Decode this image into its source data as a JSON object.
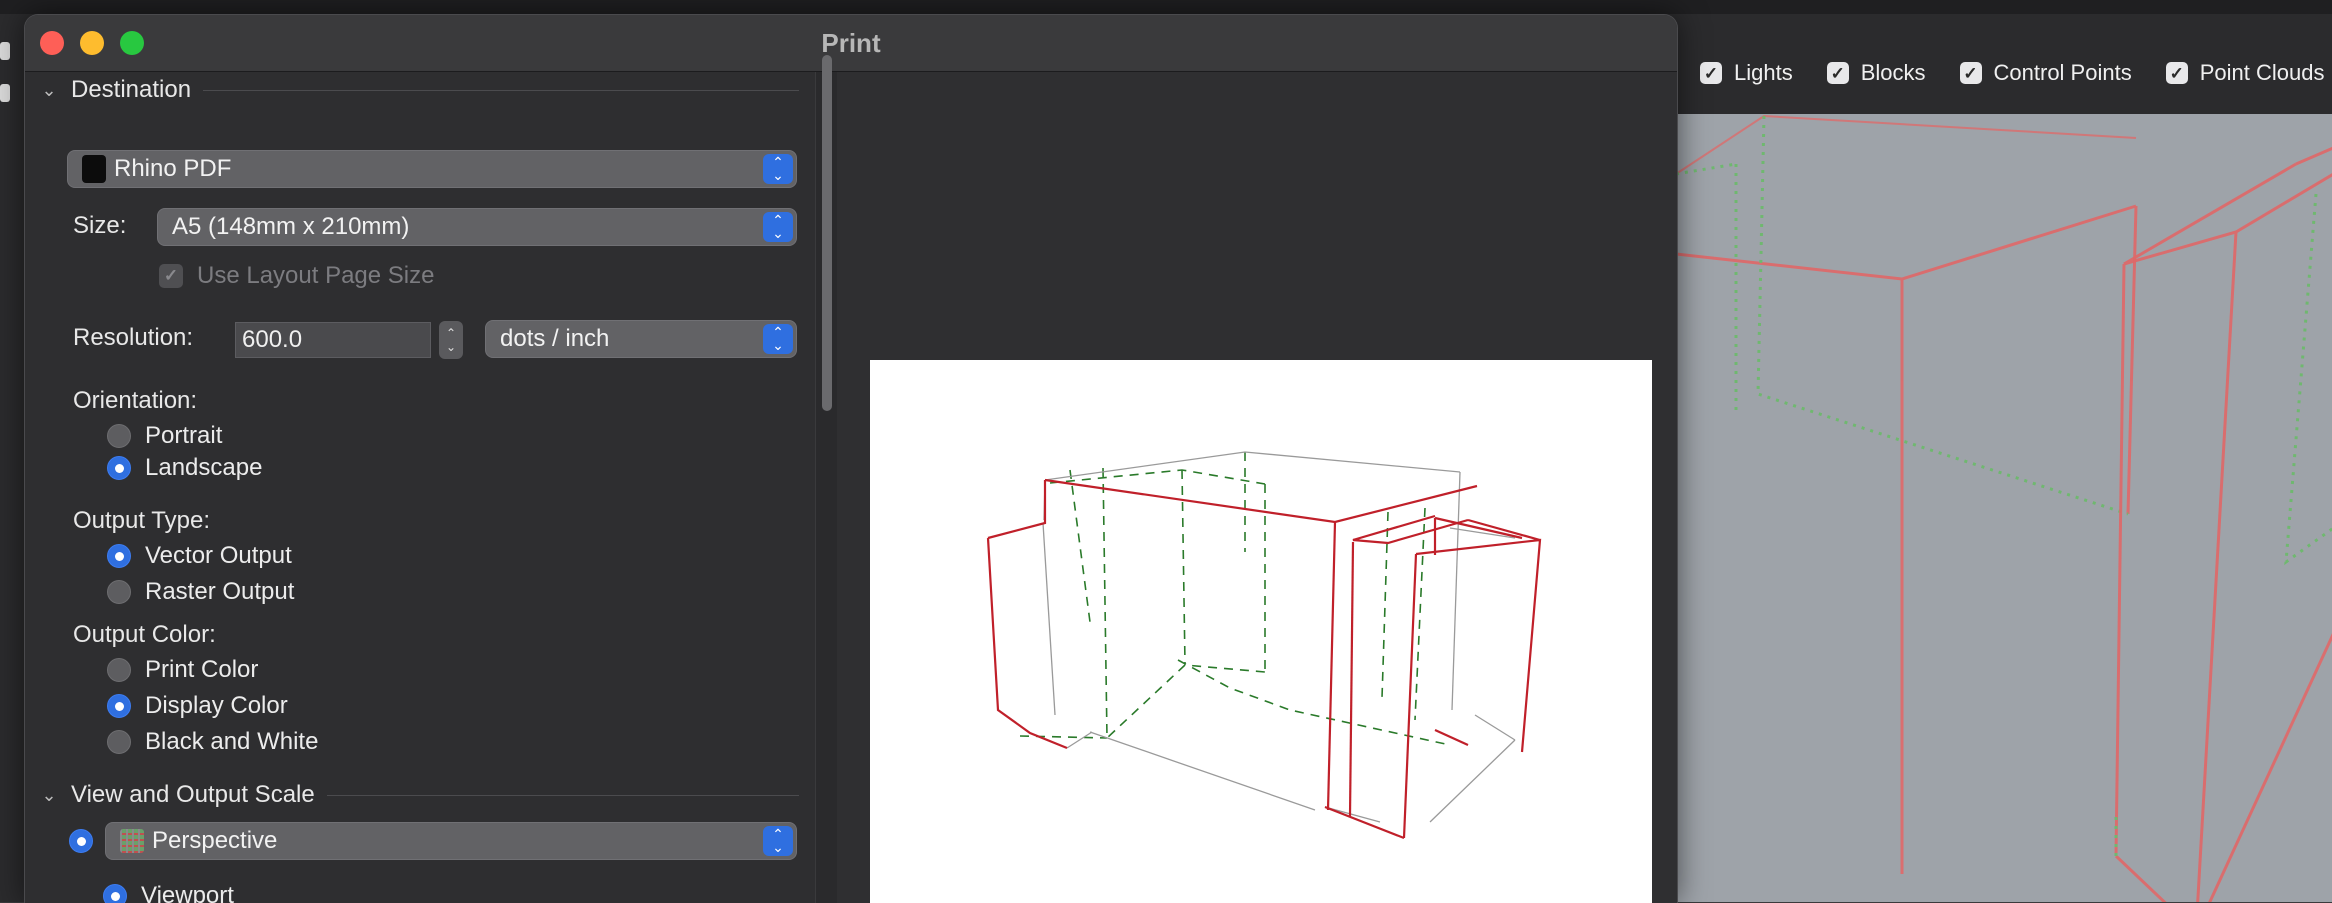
{
  "dialog": {
    "title": "Print",
    "destination": {
      "section_label": "Destination",
      "printer": "Rhino PDF",
      "size_label": "Size:",
      "size_value": "A5 (148mm x 210mm)",
      "use_layout_label": "Use Layout Page Size",
      "use_layout_checked": true,
      "resolution_label": "Resolution:",
      "resolution_value": "600.0",
      "resolution_unit": "dots / inch",
      "orientation_label": "Orientation:",
      "orientation_options": [
        "Portrait",
        "Landscape"
      ],
      "orientation_selected": "Landscape",
      "output_type_label": "Output Type:",
      "output_type_options": [
        "Vector Output",
        "Raster Output"
      ],
      "output_type_selected": "Vector Output",
      "output_color_label": "Output Color:",
      "output_color_options": [
        "Print Color",
        "Display Color",
        "Black and White"
      ],
      "output_color_selected": "Display Color"
    },
    "view_scale": {
      "section_label": "View and Output Scale",
      "view_value": "Perspective",
      "viewport_label": "Viewport"
    }
  },
  "background_app": {
    "toolbar_checks": [
      {
        "label": "Lights",
        "checked": true
      },
      {
        "label": "Blocks",
        "checked": true
      },
      {
        "label": "Control Points",
        "checked": true
      },
      {
        "label": "Point Clouds",
        "checked": true
      }
    ]
  },
  "colors": {
    "accent": "#2f6fe0",
    "curve_red": "#c0202a",
    "hidden_green": "#2a7a2a",
    "viewport_bg": "#9ea3a9"
  }
}
